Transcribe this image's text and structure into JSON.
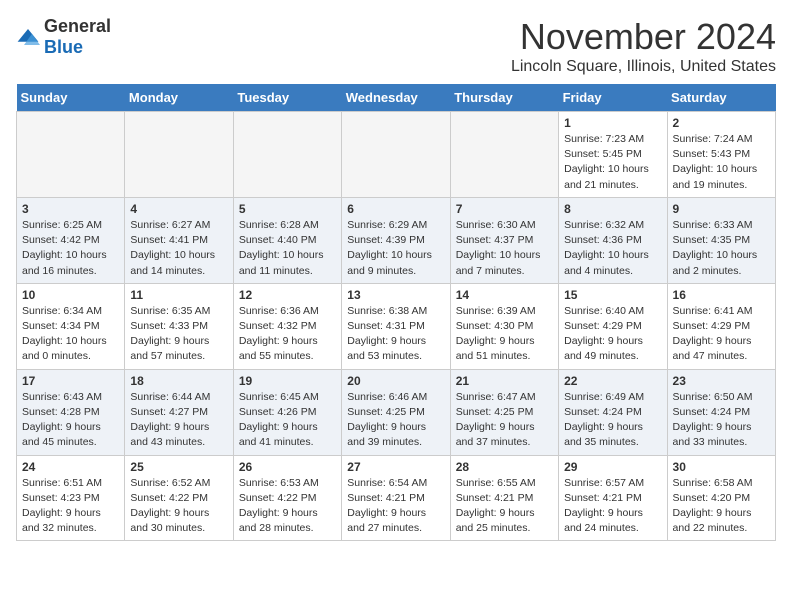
{
  "logo": {
    "general": "General",
    "blue": "Blue"
  },
  "title": "November 2024",
  "location": "Lincoln Square, Illinois, United States",
  "days_of_week": [
    "Sunday",
    "Monday",
    "Tuesday",
    "Wednesday",
    "Thursday",
    "Friday",
    "Saturday"
  ],
  "weeks": [
    [
      {
        "day": "",
        "info": ""
      },
      {
        "day": "",
        "info": ""
      },
      {
        "day": "",
        "info": ""
      },
      {
        "day": "",
        "info": ""
      },
      {
        "day": "",
        "info": ""
      },
      {
        "day": "1",
        "info": "Sunrise: 7:23 AM\nSunset: 5:45 PM\nDaylight: 10 hours and 21 minutes."
      },
      {
        "day": "2",
        "info": "Sunrise: 7:24 AM\nSunset: 5:43 PM\nDaylight: 10 hours and 19 minutes."
      }
    ],
    [
      {
        "day": "3",
        "info": "Sunrise: 6:25 AM\nSunset: 4:42 PM\nDaylight: 10 hours and 16 minutes."
      },
      {
        "day": "4",
        "info": "Sunrise: 6:27 AM\nSunset: 4:41 PM\nDaylight: 10 hours and 14 minutes."
      },
      {
        "day": "5",
        "info": "Sunrise: 6:28 AM\nSunset: 4:40 PM\nDaylight: 10 hours and 11 minutes."
      },
      {
        "day": "6",
        "info": "Sunrise: 6:29 AM\nSunset: 4:39 PM\nDaylight: 10 hours and 9 minutes."
      },
      {
        "day": "7",
        "info": "Sunrise: 6:30 AM\nSunset: 4:37 PM\nDaylight: 10 hours and 7 minutes."
      },
      {
        "day": "8",
        "info": "Sunrise: 6:32 AM\nSunset: 4:36 PM\nDaylight: 10 hours and 4 minutes."
      },
      {
        "day": "9",
        "info": "Sunrise: 6:33 AM\nSunset: 4:35 PM\nDaylight: 10 hours and 2 minutes."
      }
    ],
    [
      {
        "day": "10",
        "info": "Sunrise: 6:34 AM\nSunset: 4:34 PM\nDaylight: 10 hours and 0 minutes."
      },
      {
        "day": "11",
        "info": "Sunrise: 6:35 AM\nSunset: 4:33 PM\nDaylight: 9 hours and 57 minutes."
      },
      {
        "day": "12",
        "info": "Sunrise: 6:36 AM\nSunset: 4:32 PM\nDaylight: 9 hours and 55 minutes."
      },
      {
        "day": "13",
        "info": "Sunrise: 6:38 AM\nSunset: 4:31 PM\nDaylight: 9 hours and 53 minutes."
      },
      {
        "day": "14",
        "info": "Sunrise: 6:39 AM\nSunset: 4:30 PM\nDaylight: 9 hours and 51 minutes."
      },
      {
        "day": "15",
        "info": "Sunrise: 6:40 AM\nSunset: 4:29 PM\nDaylight: 9 hours and 49 minutes."
      },
      {
        "day": "16",
        "info": "Sunrise: 6:41 AM\nSunset: 4:29 PM\nDaylight: 9 hours and 47 minutes."
      }
    ],
    [
      {
        "day": "17",
        "info": "Sunrise: 6:43 AM\nSunset: 4:28 PM\nDaylight: 9 hours and 45 minutes."
      },
      {
        "day": "18",
        "info": "Sunrise: 6:44 AM\nSunset: 4:27 PM\nDaylight: 9 hours and 43 minutes."
      },
      {
        "day": "19",
        "info": "Sunrise: 6:45 AM\nSunset: 4:26 PM\nDaylight: 9 hours and 41 minutes."
      },
      {
        "day": "20",
        "info": "Sunrise: 6:46 AM\nSunset: 4:25 PM\nDaylight: 9 hours and 39 minutes."
      },
      {
        "day": "21",
        "info": "Sunrise: 6:47 AM\nSunset: 4:25 PM\nDaylight: 9 hours and 37 minutes."
      },
      {
        "day": "22",
        "info": "Sunrise: 6:49 AM\nSunset: 4:24 PM\nDaylight: 9 hours and 35 minutes."
      },
      {
        "day": "23",
        "info": "Sunrise: 6:50 AM\nSunset: 4:24 PM\nDaylight: 9 hours and 33 minutes."
      }
    ],
    [
      {
        "day": "24",
        "info": "Sunrise: 6:51 AM\nSunset: 4:23 PM\nDaylight: 9 hours and 32 minutes."
      },
      {
        "day": "25",
        "info": "Sunrise: 6:52 AM\nSunset: 4:22 PM\nDaylight: 9 hours and 30 minutes."
      },
      {
        "day": "26",
        "info": "Sunrise: 6:53 AM\nSunset: 4:22 PM\nDaylight: 9 hours and 28 minutes."
      },
      {
        "day": "27",
        "info": "Sunrise: 6:54 AM\nSunset: 4:21 PM\nDaylight: 9 hours and 27 minutes."
      },
      {
        "day": "28",
        "info": "Sunrise: 6:55 AM\nSunset: 4:21 PM\nDaylight: 9 hours and 25 minutes."
      },
      {
        "day": "29",
        "info": "Sunrise: 6:57 AM\nSunset: 4:21 PM\nDaylight: 9 hours and 24 minutes."
      },
      {
        "day": "30",
        "info": "Sunrise: 6:58 AM\nSunset: 4:20 PM\nDaylight: 9 hours and 22 minutes."
      }
    ]
  ]
}
